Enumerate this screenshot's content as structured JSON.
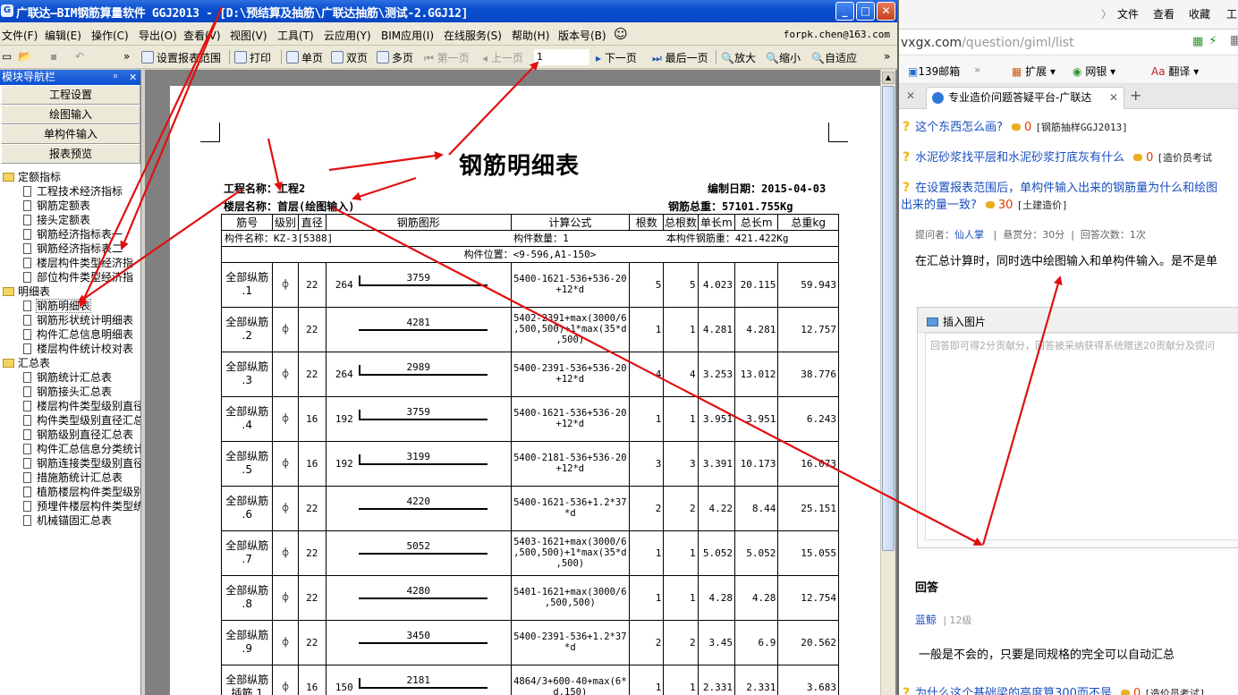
{
  "app": {
    "title": "广联达—BIM钢筋算量软件 GGJ2013 - [D:\\预结算及抽筋\\广联达抽筋\\测试-2.GGJ12]",
    "menu": [
      "文件(F)",
      "编辑(E)",
      "操作(C)",
      "导出(O)",
      "查看(V)",
      "视图(V)",
      "工具(T)",
      "云应用(Y)",
      "BIM应用(I)",
      "在线服务(S)",
      "帮助(H)",
      "版本号(B)"
    ],
    "user": "forpk.chen@163.com",
    "toolbar": {
      "report_range": "设置报表范围",
      "print": "打印",
      "single_page": "单页",
      "double_page": "双页",
      "multi_page": "多页",
      "first_page": "第一页",
      "prev_page": "上一页",
      "page_value": "1",
      "next_page": "下一页",
      "last_page": "最后一页",
      "zoom_in": "放大",
      "zoom_out": "缩小",
      "fit": "自适应"
    },
    "nav": {
      "title": "模块导航栏",
      "buttons": [
        "工程设置",
        "绘图输入",
        "单构件输入",
        "报表预览"
      ],
      "groups": [
        {
          "label": "定额指标",
          "items": [
            "工程技术经济指标",
            "钢筋定额表",
            "接头定额表",
            "钢筋经济指标表一",
            "钢筋经济指标表二",
            "楼层构件类型经济指",
            "部位构件类型经济指"
          ]
        },
        {
          "label": "明细表",
          "items": [
            "钢筋明细表",
            "钢筋形状统计明细表",
            "构件汇总信息明细表",
            "楼层构件统计校对表"
          ]
        },
        {
          "label": "汇总表",
          "items": [
            "钢筋统计汇总表",
            "钢筋接头汇总表",
            "楼层构件类型级别直径",
            "构件类型级别直径汇总",
            "钢筋级别直径汇总表",
            "构件汇总信息分类统计",
            "钢筋连接类型级别直径",
            "措施筋统计汇总表",
            "植筋楼层构件类型级别",
            "预埋件楼层构件类型统",
            "机械锚固汇总表"
          ]
        }
      ]
    },
    "report": {
      "title": "钢筋明细表",
      "project": "工程名称：工程2",
      "date": "编制日期：2015-04-03",
      "floor": "楼层名称：首层(绘图输入)",
      "total": "钢筋总重：57101.755Kg",
      "headers": [
        "筋号",
        "级别",
        "直径",
        "钢筋图形",
        "计算公式",
        "根数",
        "总根数",
        "单长m",
        "总长m",
        "总重kg"
      ],
      "component_name": "构件名称：KZ-3[5388]",
      "component_count": "构件数量：1",
      "component_weight": "本构件钢筋重：421.422Kg",
      "position": "构件位置：<9-596,A1-150>",
      "rows": [
        {
          "name1": "全部纵筋",
          "name2": ".1",
          "grade": "⌽",
          "dia": "22",
          "hook": "264",
          "len": "3759",
          "formula": "5400-1621-536+536-20\n+12*d",
          "count": "5",
          "total": "5",
          "unit": "4.023",
          "tlen": "20.115",
          "weight": "59.943"
        },
        {
          "name1": "全部纵筋",
          "name2": ".2",
          "grade": "⌽",
          "dia": "22",
          "hook": "",
          "len": "4281",
          "formula": "5402-2391+max(3000/6\n,500,500)+1*max(35*d\n,500)",
          "count": "1",
          "total": "1",
          "unit": "4.281",
          "tlen": "4.281",
          "weight": "12.757"
        },
        {
          "name1": "全部纵筋",
          "name2": ".3",
          "grade": "⌽",
          "dia": "22",
          "hook": "264",
          "len": "2989",
          "formula": "5400-2391-536+536-20\n+12*d",
          "count": "4",
          "total": "4",
          "unit": "3.253",
          "tlen": "13.012",
          "weight": "38.776"
        },
        {
          "name1": "全部纵筋",
          "name2": ".4",
          "grade": "⌽",
          "dia": "16",
          "hook": "192",
          "len": "3759",
          "formula": "5400-1621-536+536-20\n+12*d",
          "count": "1",
          "total": "1",
          "unit": "3.951",
          "tlen": "3.951",
          "weight": "6.243"
        },
        {
          "name1": "全部纵筋",
          "name2": ".5",
          "grade": "⌽",
          "dia": "16",
          "hook": "192",
          "len": "3199",
          "formula": "5400-2181-536+536-20\n+12*d",
          "count": "3",
          "total": "3",
          "unit": "3.391",
          "tlen": "10.173",
          "weight": "16.073"
        },
        {
          "name1": "全部纵筋",
          "name2": ".6",
          "grade": "⌽",
          "dia": "22",
          "hook": "",
          "len": "4220",
          "formula": "5400-1621-536+1.2*37\n*d",
          "count": "2",
          "total": "2",
          "unit": "4.22",
          "tlen": "8.44",
          "weight": "25.151"
        },
        {
          "name1": "全部纵筋",
          "name2": ".7",
          "grade": "⌽",
          "dia": "22",
          "hook": "",
          "len": "5052",
          "formula": "5403-1621+max(3000/6\n,500,500)+1*max(35*d\n,500)",
          "count": "1",
          "total": "1",
          "unit": "5.052",
          "tlen": "5.052",
          "weight": "15.055"
        },
        {
          "name1": "全部纵筋",
          "name2": ".8",
          "grade": "⌽",
          "dia": "22",
          "hook": "",
          "len": "4280",
          "formula": "5401-1621+max(3000/6\n,500,500)",
          "count": "1",
          "total": "1",
          "unit": "4.28",
          "tlen": "4.28",
          "weight": "12.754"
        },
        {
          "name1": "全部纵筋",
          "name2": ".9",
          "grade": "⌽",
          "dia": "22",
          "hook": "",
          "len": "3450",
          "formula": "5400-2391-536+1.2*37\n*d",
          "count": "2",
          "total": "2",
          "unit": "3.45",
          "tlen": "6.9",
          "weight": "20.562"
        },
        {
          "name1": "全部纵筋",
          "name2": "插筋.1",
          "grade": "⌽",
          "dia": "16",
          "hook": "150",
          "len": "2181",
          "formula": "4864/3+600-40+max(6*\nd,150)",
          "count": "1",
          "total": "1",
          "unit": "2.331",
          "tlen": "2.331",
          "weight": "3.683"
        }
      ]
    }
  },
  "browser": {
    "menu": [
      "文件",
      "查看",
      "收藏",
      "工"
    ],
    "url_domain": "vxgx.com",
    "url_path": "/question/giml/list",
    "bookmarks": [
      "139邮箱",
      "扩展",
      "网银",
      "翻译"
    ],
    "tab_title": "专业造价问题答疑平台-广联达",
    "questions": [
      {
        "text": "这个东西怎么画?",
        "count": "0",
        "tag": "[钢筋抽样GGJ2013]"
      },
      {
        "text": "水泥砂浆找平层和水泥砂浆打底灰有什么",
        "count": "0",
        "tag": "[造价员考试"
      },
      {
        "text": "在设置报表范围后，单构件输入出来的钢筋量为什么和绘图",
        "count": "30",
        "tag": "[土建造价]",
        "text2": "出来的量一致?"
      }
    ],
    "meta": {
      "asker_label": "提问者：",
      "asker": "仙人掌",
      "reward": "悬赏分：30分",
      "answers": "回答次数：1次"
    },
    "question_body": "在汇总计算时，同时选中绘图输入和单构件输入。是不是单",
    "insert_image": "插入图片",
    "editor_placeholder": "回答即可得2分贡献分，回答被采纳获得系统赠送20贡献分及提问",
    "answer_heading": "回答",
    "answer_user": "蓝鲸",
    "answer_level": "12级",
    "answer_body": "一般是不会的，只要是同规格的完全可以自动汇总",
    "bottom_question": {
      "text": "为什么这个基础梁的高度算300而不是",
      "count": "0",
      "tag": "[造价员考试]"
    }
  },
  "colors": {
    "titlebar": "#0a4fd0",
    "arrow": "#e01010",
    "link": "#1a4fc0"
  }
}
